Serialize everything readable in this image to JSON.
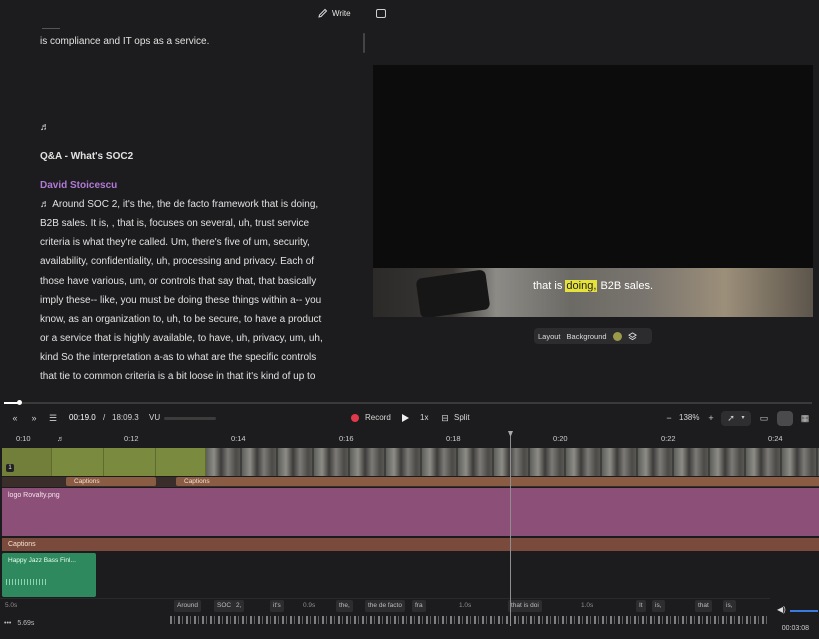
{
  "topbar": {
    "write_label": "Write"
  },
  "transcript": {
    "line0": "is compliance and IT ops as a service.",
    "music_note": "♬",
    "heading": "Q&A - What's SOC2",
    "speaker": "David Stoicescu",
    "lines": [
      "♬  Around SOC 2, it's the, the de facto  framework that is doing,",
      "B2B sales. It is, ,  that is, focuses on several, uh, trust service",
      "criteria is what they're called. Um, there's five of um, security,",
      "availability, confidentiality, uh, processing and privacy. Each of",
      "those have various, um,  or controls that say that, that basically",
      "imply these-- like, you must be doing these things within a-- you",
      "know, as an organization to, uh, to be secure, to have a product",
      "or a service that is highly available, to have, uh, privacy, um, uh,",
      "kind So the interpretation a-as to what are the specific controls",
      "that tie to common criteria is a bit loose in that it's kind of up to"
    ]
  },
  "preview": {
    "caption_before": "that is ",
    "caption_highlight": "doing,",
    "caption_after": " B2B sales.",
    "layout_label": "Layout",
    "background_label": "Background",
    "background_color": "#9a9a4a"
  },
  "toolbar": {
    "time_current": "00:19.0",
    "time_sep": "/",
    "time_total": "18:09.3",
    "vu_label": "VU",
    "record_label": "Record",
    "speed_label": "1x",
    "split_label": "Split",
    "zoom_label": "138%"
  },
  "ruler": {
    "ticks": [
      "0:10",
      "♬",
      "0:12",
      "0:14",
      "0:16",
      "0:18",
      "0:20",
      "0:22",
      "0:24"
    ]
  },
  "tracks": {
    "track_number": "1",
    "captions_chip_1": "Captions",
    "captions_chip_2": "Captions",
    "logo_label": "logo Rovalty.png",
    "captions_label": "Captions",
    "audio_label": "Happy Jazz Bass Finl..."
  },
  "words": {
    "gap_start": "5.0s",
    "items": [
      "Around",
      "SOC",
      "2,",
      "it's",
      "the,",
      "the de facto",
      "fra",
      "that is doi",
      "It",
      "is,",
      "that",
      "is,"
    ],
    "gaps": [
      "0.9s",
      "1.0s",
      "1.0s"
    ],
    "bottom_gap": "5.69s",
    "timecode": "00:03:08"
  },
  "colors": {
    "accent_record": "#e03a4a",
    "speaker": "#b07ad6",
    "logo_track": "#8c4f78",
    "audio_track": "#2e8a5e",
    "caption_highlight": "#e6e23c"
  }
}
